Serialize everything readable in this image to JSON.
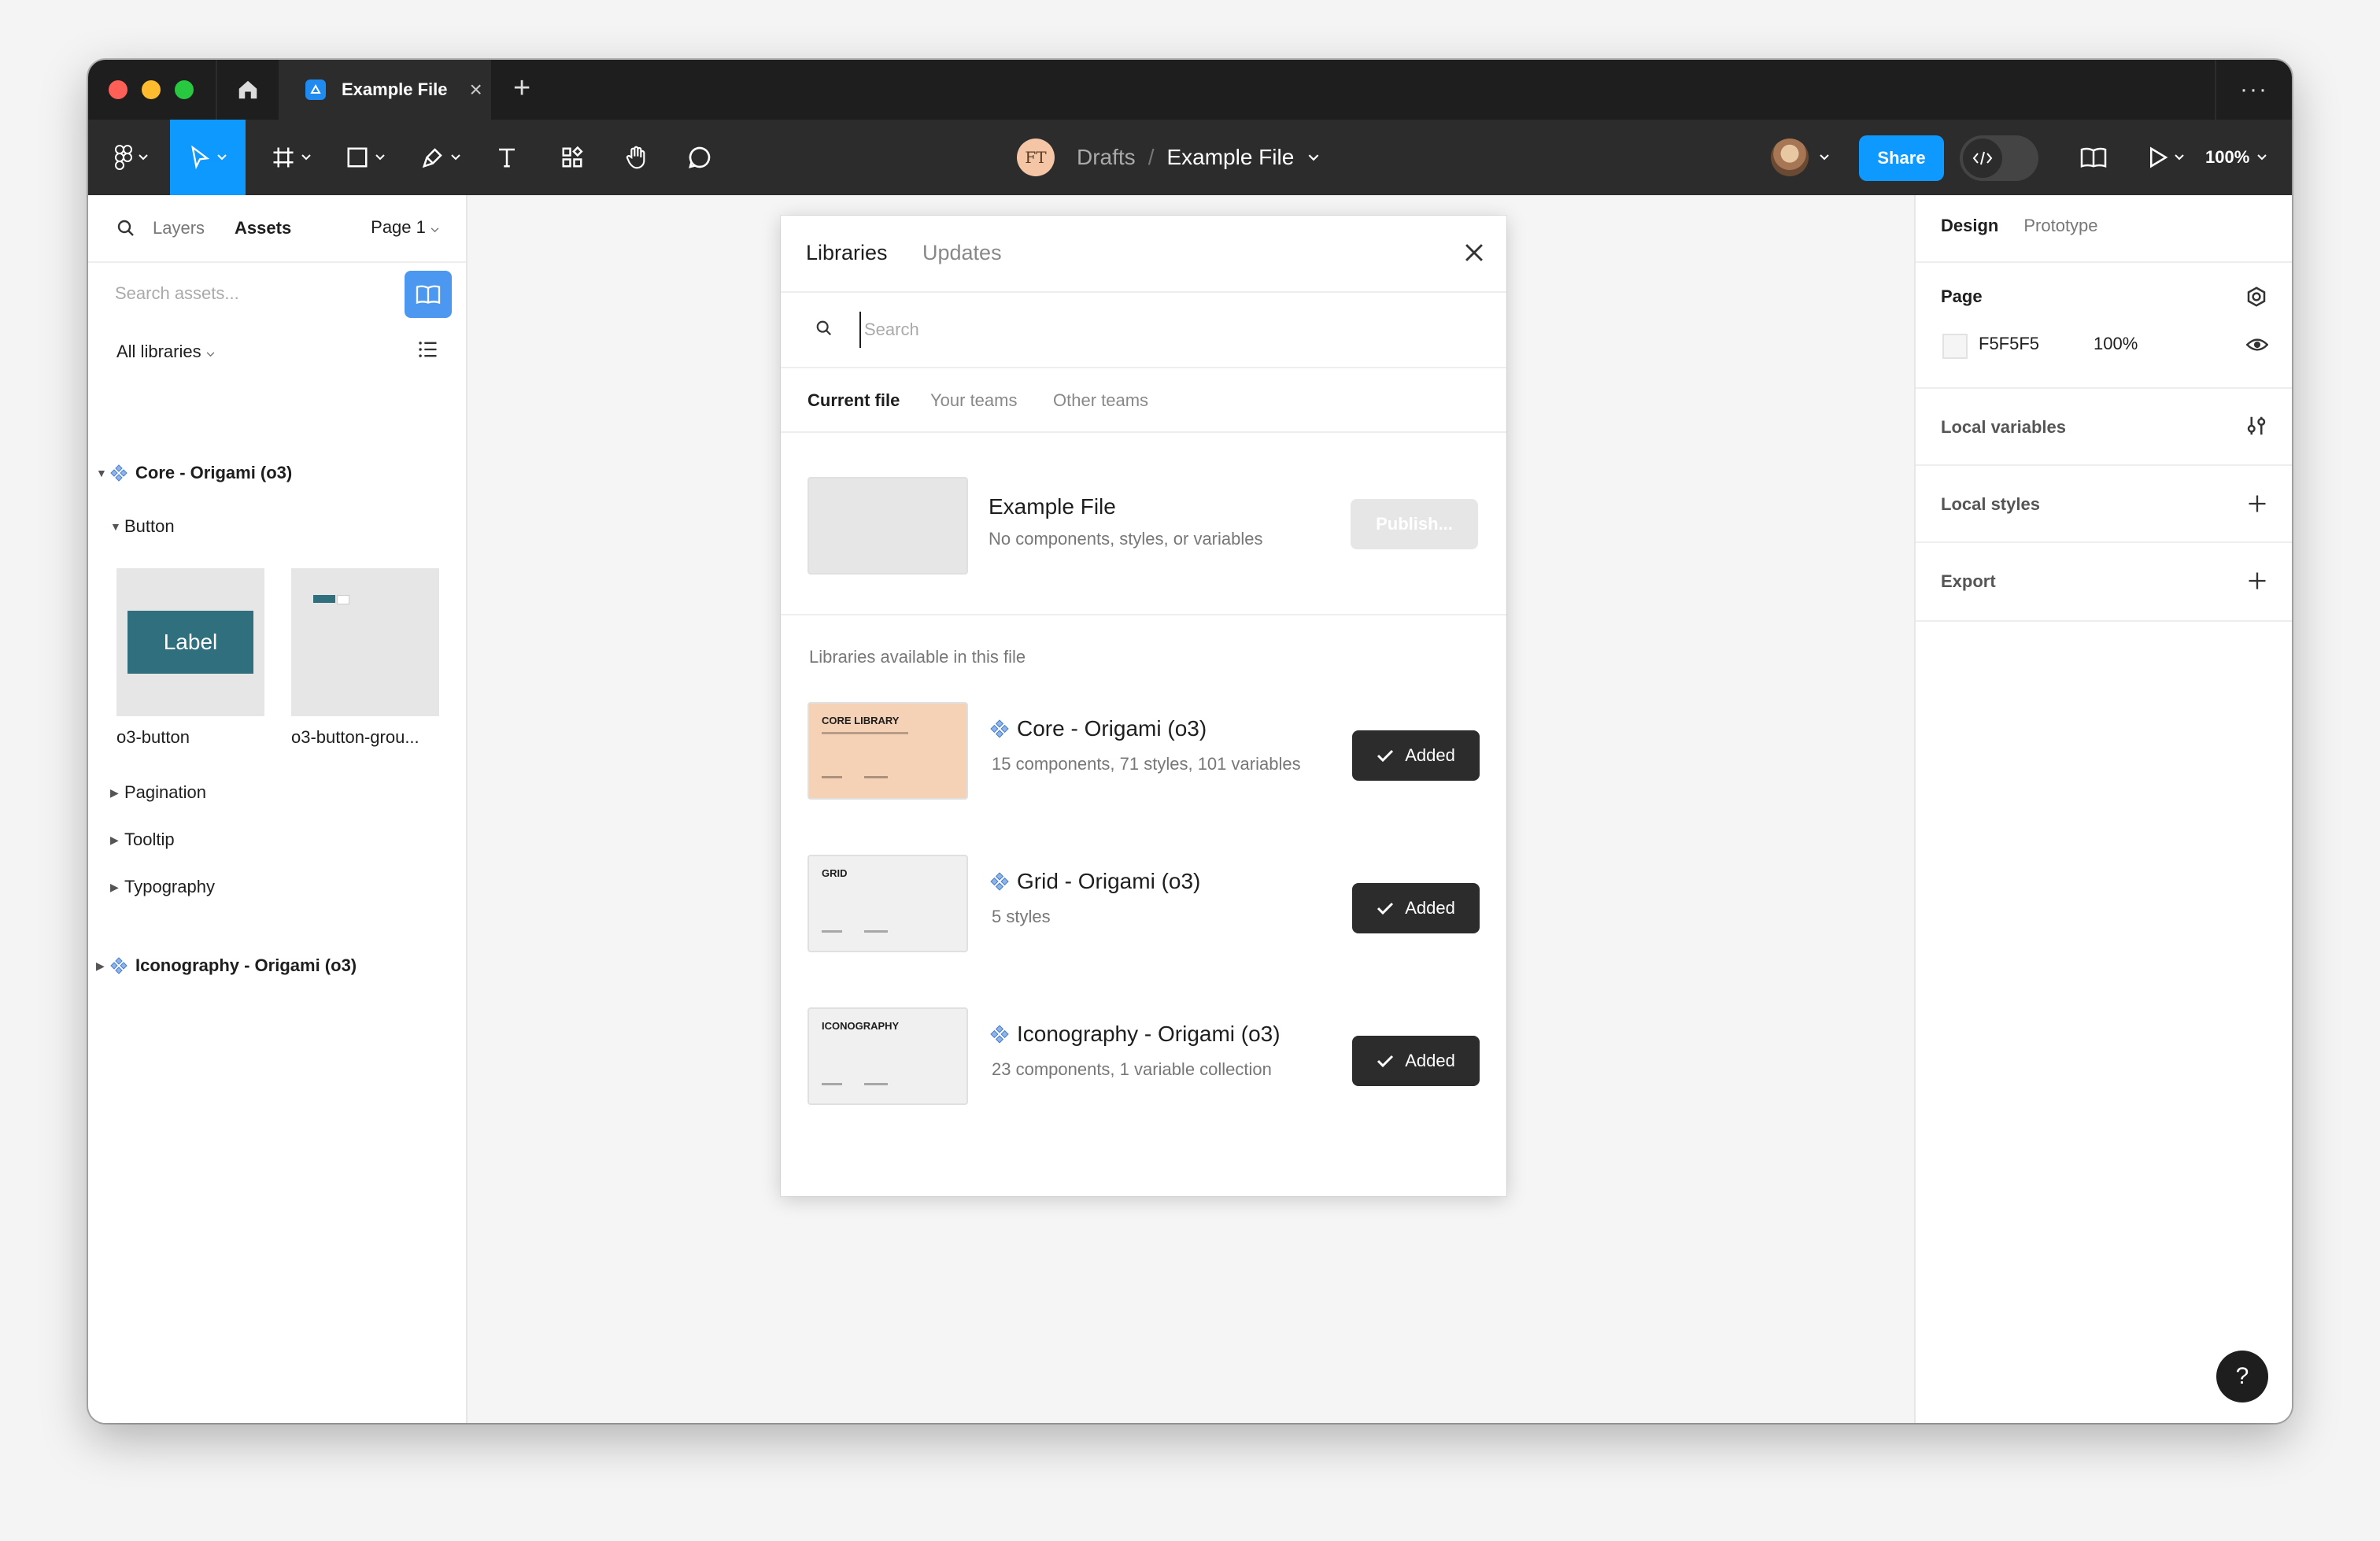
{
  "titlebar": {
    "tab_title": "Example File",
    "close_glyph": "×",
    "new_tab_glyph": "+",
    "more_glyph": "···"
  },
  "toolbar": {
    "breadcrumb_initials": "FT",
    "breadcrumb_folder": "Drafts",
    "breadcrumb_separator": "/",
    "breadcrumb_file": "Example File",
    "share_label": "Share",
    "zoom_label": "100%"
  },
  "left_panel": {
    "tab_layers": "Layers",
    "tab_assets": "Assets",
    "page_selector": "Page 1",
    "search_placeholder": "Search assets...",
    "libraries_filter": "All libraries",
    "tree": {
      "core_library": "Core - Origami (o3)",
      "group_button": "Button",
      "thumb_button_text": "Label",
      "thumb_button_name": "o3-button",
      "thumb_group_name": "o3-button-grou...",
      "group_pagination": "Pagination",
      "group_tooltip": "Tooltip",
      "group_typography": "Typography",
      "iconography_library": "Iconography - Origami (o3)"
    }
  },
  "right_panel": {
    "tab_design": "Design",
    "tab_prototype": "Prototype",
    "page_title": "Page",
    "page_color_hex": "F5F5F5",
    "page_opacity": "100%",
    "local_variables": "Local variables",
    "local_styles": "Local styles",
    "export": "Export",
    "help_glyph": "?"
  },
  "modal": {
    "tab_libraries": "Libraries",
    "tab_updates": "Updates",
    "search_placeholder": "Search",
    "filter_current": "Current file",
    "filter_your_teams": "Your teams",
    "filter_other_teams": "Other teams",
    "current_file": {
      "name": "Example File",
      "subtitle": "No components, styles, or variables",
      "publish_label": "Publish..."
    },
    "available_label": "Libraries available in this file",
    "libraries": [
      {
        "name": "Core - Origami (o3)",
        "subtitle": "15 components, 71 styles, 101 variables",
        "thumb_title": "CORE LIBRARY",
        "button_label": "Added"
      },
      {
        "name": "Grid - Origami (o3)",
        "subtitle": "5 styles",
        "thumb_title": "GRID",
        "button_label": "Added"
      },
      {
        "name": "Iconography - Origami (o3)",
        "subtitle": "23 components, 1 variable collection",
        "thumb_title": "ICONOGRAPHY",
        "button_label": "Added"
      }
    ]
  },
  "colors": {
    "accent_blue": "#0d99ff",
    "toolbar_bg": "#2c2c2c",
    "titlebar_bg": "#1e1e1e",
    "canvas_bg": "#f5f5f5",
    "core_thumb": "#f5d1b5",
    "o3_button": "#2f6f7e"
  },
  "icons": {
    "home": "home-icon",
    "file_tab": "figma-file-icon",
    "main_menu": "figma-logo-icon",
    "move": "cursor-icon",
    "frame": "frame-icon",
    "shape": "rectangle-icon",
    "pen": "pen-icon",
    "text": "text-icon",
    "resources": "resources-icon",
    "hand": "hand-icon",
    "comment": "comment-icon",
    "library": "book-icon",
    "present": "play-icon",
    "component": "component-icon",
    "styles": "styles-icon",
    "eye": "eye-icon",
    "variables": "variables-icon",
    "plus": "plus-icon",
    "check": "check-icon",
    "close": "close-icon",
    "search": "search-icon",
    "list": "list-icon"
  }
}
